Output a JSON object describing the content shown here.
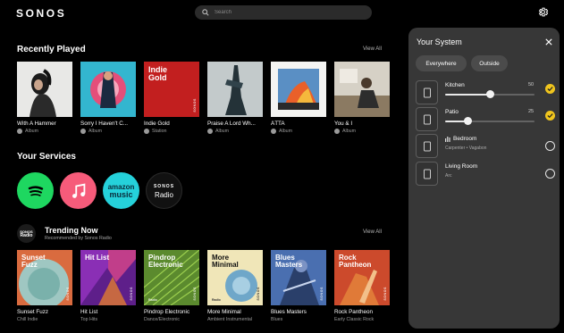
{
  "app": {
    "logo": "SONOS"
  },
  "search": {
    "placeholder": "Search"
  },
  "recently_played": {
    "title": "Recently Played",
    "view_all": "View All",
    "items": [
      {
        "title": "With A Hammer",
        "type": "Album",
        "source_icon": "apple-music-icon"
      },
      {
        "title": "Sorry I Haven't C...",
        "type": "Album",
        "source_icon": "spotify-icon"
      },
      {
        "title": "Indie Gold",
        "type": "Station",
        "source_icon": "sonos-radio-icon",
        "art_label": "Indie\nGold"
      },
      {
        "title": "Praise A Lord Wh...",
        "type": "Album",
        "source_icon": "apple-music-icon"
      },
      {
        "title": "ÁTTA",
        "type": "Album",
        "source_icon": "spotify-icon"
      },
      {
        "title": "You & I",
        "type": "Album",
        "source_icon": "apple-music-icon"
      }
    ]
  },
  "services": {
    "title": "Your Services",
    "items": [
      {
        "name": "Spotify",
        "icon": "spotify-logo",
        "color": "#1ed760"
      },
      {
        "name": "Apple Music",
        "icon": "apple-music-logo",
        "color": "#f65b7a"
      },
      {
        "name": "Amazon Music",
        "icon": "amazon-music-logo",
        "color": "#25d1da",
        "label_top": "amazon",
        "label_bottom": "music"
      },
      {
        "name": "Sonos Radio",
        "icon": "sonos-radio-logo",
        "color": "#111111",
        "label_top": "SONOS",
        "label_bottom": "Radio"
      }
    ]
  },
  "trending": {
    "badge_top": "SONOS",
    "badge_bottom": "Radio",
    "title": "Trending Now",
    "subtitle": "Recommended by Sonos Radio",
    "view_all": "View All",
    "items": [
      {
        "title": "Sunset Fuzz",
        "genre": "Chill Indie",
        "art_label": "Sunset\nFuzz"
      },
      {
        "title": "Hit List",
        "genre": "Top Hits",
        "art_label": "Hit List"
      },
      {
        "title": "Pindrop Electronic",
        "genre": "Dance/Electronic",
        "art_label": "Pindrop\nElectronic"
      },
      {
        "title": "More Minimal",
        "genre": "Ambient Instrumental",
        "art_label": "More\nMinimal"
      },
      {
        "title": "Blues Masters",
        "genre": "Blues",
        "art_label": "Blues\nMasters"
      },
      {
        "title": "Rock Pantheon",
        "genre": "Early Classic Rock",
        "art_label": "Rock\nPantheon"
      }
    ],
    "art_brand": "SONOS",
    "art_radio": "Radio"
  },
  "system_panel": {
    "title": "Your System",
    "groups": [
      "Everywhere",
      "Outside"
    ],
    "rooms": [
      {
        "name": "Kitchen",
        "volume": "50",
        "volume_fraction": 0.5,
        "selected": true
      },
      {
        "name": "Patio",
        "volume": "25",
        "volume_fraction": 0.25,
        "selected": true
      },
      {
        "name": "Bedroom",
        "sub": "Carpenter • Vagabon",
        "playing": true,
        "selected": false
      },
      {
        "name": "Living Room",
        "sub": "Arc",
        "selected": false
      }
    ]
  },
  "colors": {
    "accent": "#f0c51e",
    "panel_bg": "#373737",
    "background": "#000000"
  }
}
